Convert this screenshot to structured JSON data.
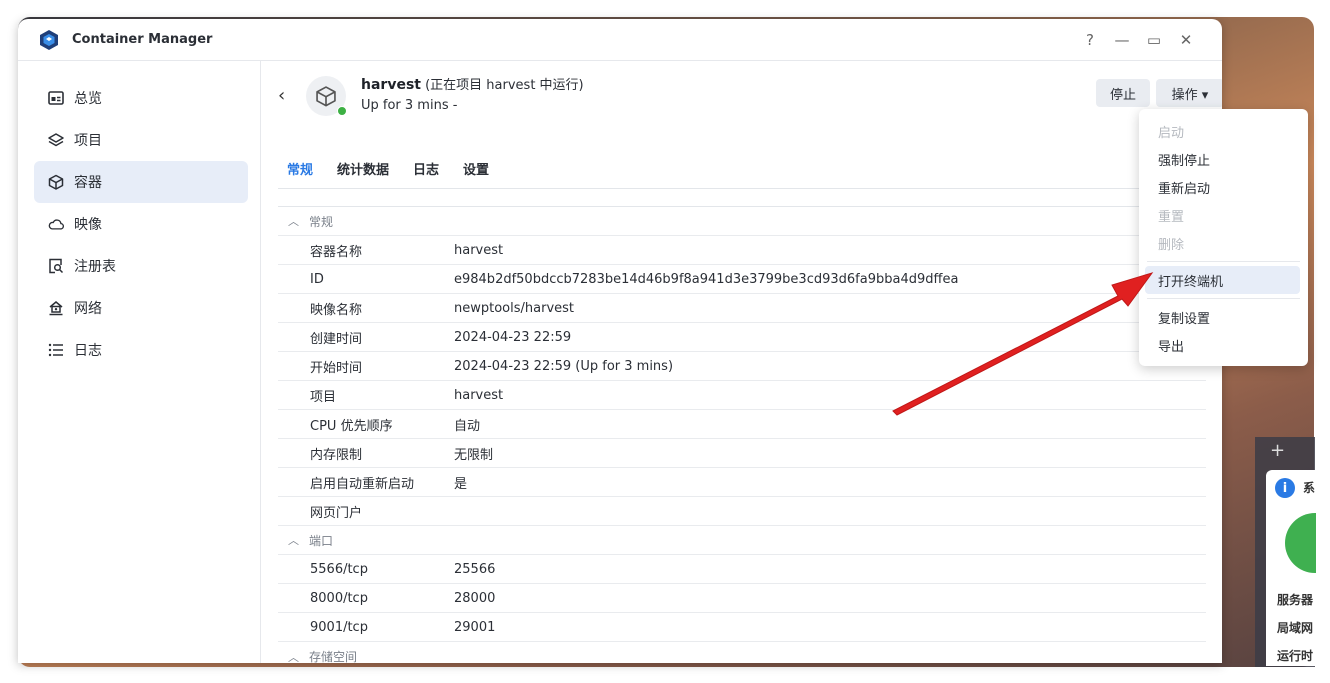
{
  "app": {
    "title": "Container Manager"
  },
  "window_controls": {
    "help": "?",
    "minimize": "—",
    "maximize": "▭",
    "close": "✕"
  },
  "sidebar": {
    "items": [
      {
        "label": "总览",
        "icon": "overview-icon",
        "active": false
      },
      {
        "label": "项目",
        "icon": "layers-icon",
        "active": false
      },
      {
        "label": "容器",
        "icon": "cube-icon",
        "active": true
      },
      {
        "label": "映像",
        "icon": "cloud-icon",
        "active": false
      },
      {
        "label": "注册表",
        "icon": "registry-search-icon",
        "active": false
      },
      {
        "label": "网络",
        "icon": "network-icon",
        "active": false
      },
      {
        "label": "日志",
        "icon": "list-icon",
        "active": false
      }
    ]
  },
  "header": {
    "name": "harvest",
    "running_note": " (正在项目 harvest 中运行)",
    "uptime": "Up for 3 mins -",
    "status_color": "#3cb043"
  },
  "buttons": {
    "stop": "停止",
    "actions": "操作 ▾"
  },
  "tabs": [
    {
      "label": "常规",
      "active": true
    },
    {
      "label": "统计数据",
      "active": false
    },
    {
      "label": "日志",
      "active": false
    },
    {
      "label": "设置",
      "active": false
    }
  ],
  "sections": {
    "general": {
      "title": "常规",
      "rows": [
        {
          "key": "容器名称",
          "value": "harvest"
        },
        {
          "key": "ID",
          "value": "e984b2df50bdccb7283be14d46b9f8a941d3e3799be3cd93d6fa9bba4d9dffea"
        },
        {
          "key": "映像名称",
          "value": "newptools/harvest"
        },
        {
          "key": "创建时间",
          "value": "2024-04-23 22:59"
        },
        {
          "key": "开始时间",
          "value": "2024-04-23 22:59 (Up for 3 mins)"
        },
        {
          "key": "项目",
          "value": "harvest"
        },
        {
          "key": "CPU 优先顺序",
          "value": "自动"
        },
        {
          "key": "内存限制",
          "value": "无限制"
        },
        {
          "key": "启用自动重新启动",
          "value": "是"
        },
        {
          "key": "网页门户",
          "value": ""
        }
      ]
    },
    "ports": {
      "title": "端口",
      "rows": [
        {
          "key": "5566/tcp",
          "value": "25566"
        },
        {
          "key": "8000/tcp",
          "value": "28000"
        },
        {
          "key": "9001/tcp",
          "value": "29001"
        }
      ]
    },
    "storage": {
      "title": "存储空间"
    }
  },
  "actions_menu": {
    "items": [
      {
        "label": "启动",
        "disabled": true
      },
      {
        "label": "强制停止",
        "disabled": false
      },
      {
        "label": "重新启动",
        "disabled": false
      },
      {
        "label": "重置",
        "disabled": true
      },
      {
        "label": "删除",
        "disabled": true
      },
      {
        "label": "打开终端机",
        "disabled": false,
        "highlighted": true
      },
      {
        "label": "复制设置",
        "disabled": false
      },
      {
        "label": "导出",
        "disabled": false
      }
    ]
  },
  "widget": {
    "plus": "+",
    "info": "i",
    "title": "系",
    "lines": [
      "服务器",
      "局域网",
      "运行时"
    ]
  },
  "colors": {
    "accent": "#2a7ae4",
    "arrow": "#e02020"
  }
}
